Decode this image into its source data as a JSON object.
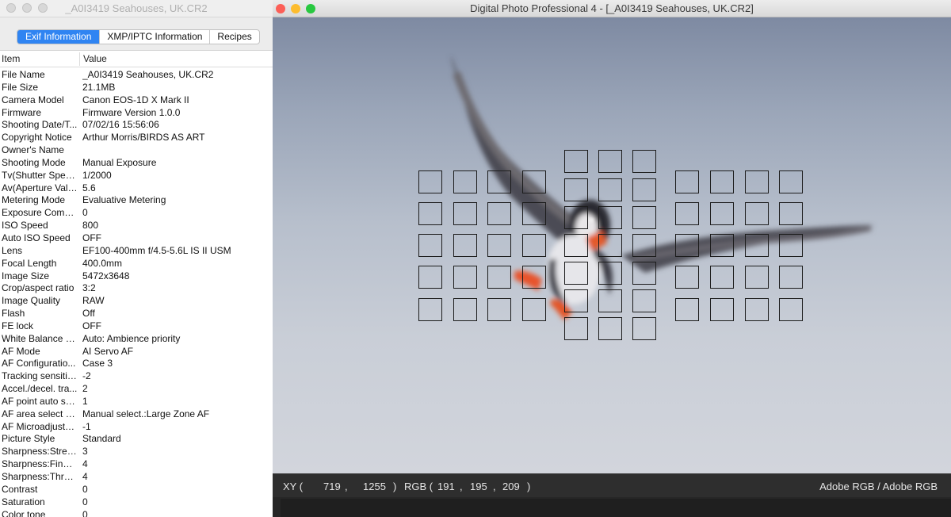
{
  "info_window": {
    "title": "_A0I3419 Seahouses, UK.CR2",
    "tabs": [
      {
        "label": "Exif Information",
        "active": true
      },
      {
        "label": "XMP/IPTC Information",
        "active": false
      },
      {
        "label": "Recipes",
        "active": false
      }
    ],
    "columns": {
      "item": "Item",
      "value": "Value"
    },
    "rows": [
      {
        "item": "File Name",
        "value": "_A0I3419 Seahouses, UK.CR2"
      },
      {
        "item": "File Size",
        "value": "21.1MB"
      },
      {
        "item": "Camera Model",
        "value": "Canon EOS-1D X Mark II"
      },
      {
        "item": "Firmware",
        "value": "Firmware Version 1.0.0"
      },
      {
        "item": "Shooting Date/T...",
        "value": "07/02/16 15:56:06"
      },
      {
        "item": "Copyright Notice",
        "value": "Arthur Morris/BIRDS AS ART"
      },
      {
        "item": "Owner's Name",
        "value": ""
      },
      {
        "item": "Shooting Mode",
        "value": "Manual Exposure"
      },
      {
        "item": "Tv(Shutter Speed)",
        "value": "1/2000"
      },
      {
        "item": "Av(Aperture Value)",
        "value": "5.6"
      },
      {
        "item": "Metering Mode",
        "value": "Evaluative Metering"
      },
      {
        "item": "Exposure Comp...",
        "value": "0"
      },
      {
        "item": "ISO Speed",
        "value": "800"
      },
      {
        "item": "Auto ISO Speed",
        "value": "OFF"
      },
      {
        "item": "Lens",
        "value": "EF100-400mm f/4.5-5.6L IS II USM"
      },
      {
        "item": "Focal Length",
        "value": "400.0mm"
      },
      {
        "item": "Image Size",
        "value": "5472x3648"
      },
      {
        "item": "Crop/aspect ratio",
        "value": "3:2"
      },
      {
        "item": "Image Quality",
        "value": "RAW"
      },
      {
        "item": "Flash",
        "value": "Off"
      },
      {
        "item": "FE lock",
        "value": "OFF"
      },
      {
        "item": "White Balance M...",
        "value": "Auto: Ambience priority"
      },
      {
        "item": "AF Mode",
        "value": "AI Servo AF"
      },
      {
        "item": "AF Configuratio...",
        "value": "Case 3"
      },
      {
        "item": "Tracking sensitivity",
        "value": "-2"
      },
      {
        "item": "Accel./decel. tra...",
        "value": "2"
      },
      {
        "item": "AF point auto sw...",
        "value": "1"
      },
      {
        "item": "AF area select m...",
        "value": "Manual select.:Large Zone AF"
      },
      {
        "item": "AF Microadjustm...",
        "value": "-1"
      },
      {
        "item": "Picture Style",
        "value": "Standard"
      },
      {
        "item": "Sharpness:Stren...",
        "value": "3"
      },
      {
        "item": "Sharpness:Finen...",
        "value": "4"
      },
      {
        "item": "Sharpness:Thres...",
        "value": "4"
      },
      {
        "item": "Contrast",
        "value": "0"
      },
      {
        "item": "Saturation",
        "value": "0"
      },
      {
        "item": "Color tone",
        "value": "0"
      }
    ]
  },
  "main_window": {
    "title": "Digital Photo Professional 4 - [_A0I3419 Seahouses, UK.CR2]",
    "status": {
      "xy_label": "XY (",
      "x": "719",
      "comma1": ",",
      "y": "1255",
      "close1": ")",
      "rgb_label": "RGB (",
      "r": "191",
      "comma2": ",",
      "g": "195",
      "comma3": ",",
      "b": "209",
      "close2": ")",
      "color_space": "Adobe RGB / Adobe RGB"
    }
  },
  "colors": {
    "tab_active": "#2f84f2",
    "close_light": "#fc5f57",
    "minimize_light": "#fdbc2e",
    "zoom_light": "#28c840",
    "status_bg": "#2e2e2e"
  },
  "icons": {
    "close": "close-icon",
    "minimize": "minimize-icon",
    "zoom": "zoom-icon"
  }
}
